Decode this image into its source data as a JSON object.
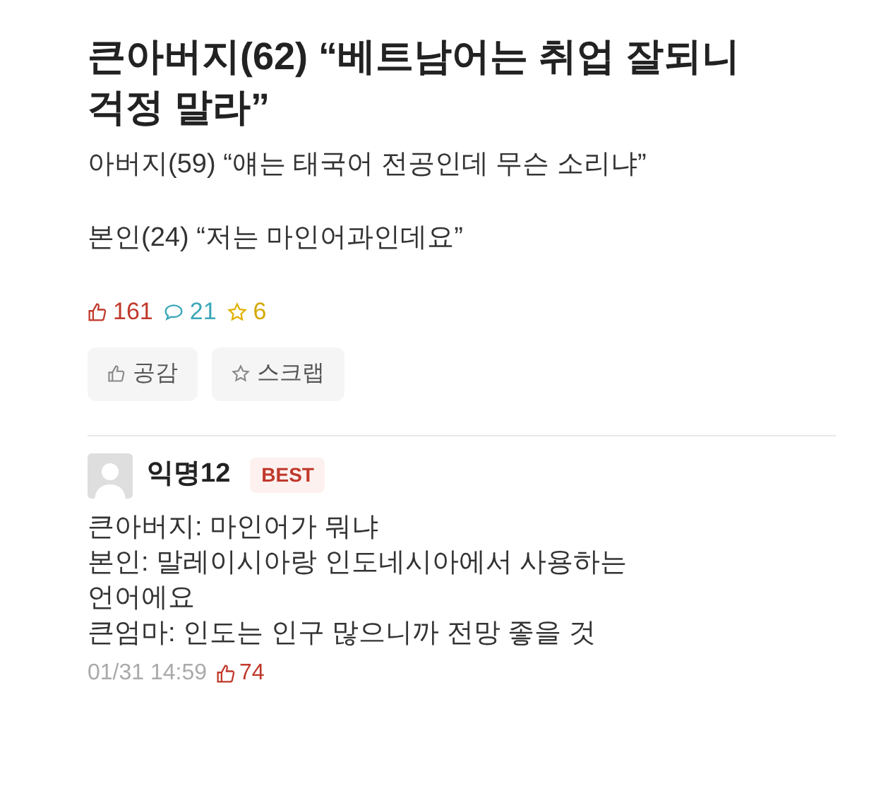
{
  "post": {
    "title": "큰아버지(62) “베트남어는 취업 잘되니 걱정 말라”",
    "paragraphs": [
      "아버지(59) “얘는 태국어 전공인데 무슨 소리냐”",
      "본인(24) “저는 마인어과인데요”"
    ],
    "stats": {
      "likes": "161",
      "comments": "21",
      "scraps": "6"
    },
    "buttons": [
      {
        "kind": "like",
        "label": "공감"
      },
      {
        "kind": "scrap",
        "label": "스크랩"
      }
    ]
  },
  "comment": {
    "author": "익명12",
    "badge": "BEST",
    "lines": [
      "큰아버지: 마인어가 뭐냐",
      "본인: 말레이시아랑 인도네시아에서 사용하는 언어에요",
      "큰엄마: 인도는 인구 많으니까 전망 좋을 것"
    ],
    "time": "01/31 14:59",
    "likes": "74"
  }
}
